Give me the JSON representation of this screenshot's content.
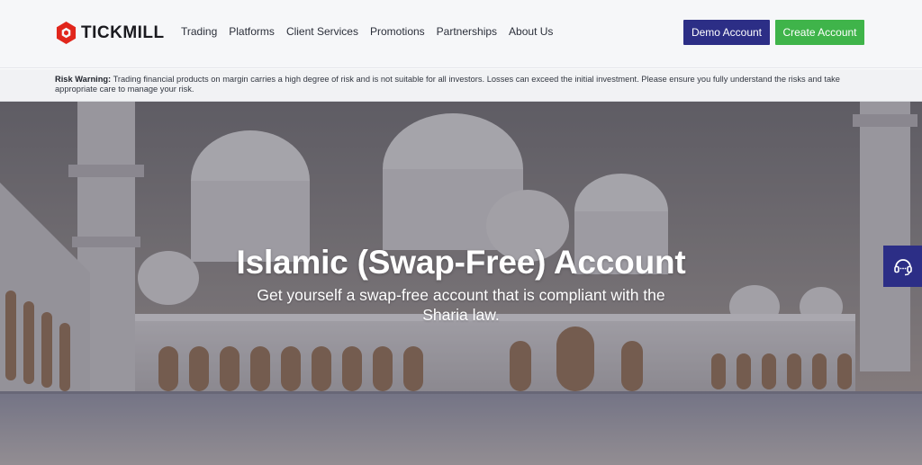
{
  "brand": {
    "name": "TICKMILL"
  },
  "nav": {
    "items": [
      {
        "label": "Trading"
      },
      {
        "label": "Platforms"
      },
      {
        "label": "Client Services"
      },
      {
        "label": "Promotions"
      },
      {
        "label": "Partnerships"
      },
      {
        "label": "About Us"
      }
    ]
  },
  "header_buttons": {
    "demo": "Demo Account",
    "create": "Create Account"
  },
  "risk_warning": {
    "label": "Risk Warning:",
    "text": " Trading financial products on margin carries a high degree of risk and is not suitable for all investors. Losses can exceed the initial investment. Please ensure you fully understand the risks and take appropriate care to manage your risk."
  },
  "hero": {
    "title": "Islamic (Swap-Free) Account",
    "subtitle": "Get yourself a swap-free account that is compliant with the Sharia law."
  },
  "icons": {
    "logo": "tickmill-logo-icon",
    "support": "headset-icon"
  },
  "colors": {
    "demo_button": "#2c2e86",
    "create_button": "#3fb44a",
    "logo_red": "#e1261c",
    "support_widget": "#2c2e86"
  }
}
